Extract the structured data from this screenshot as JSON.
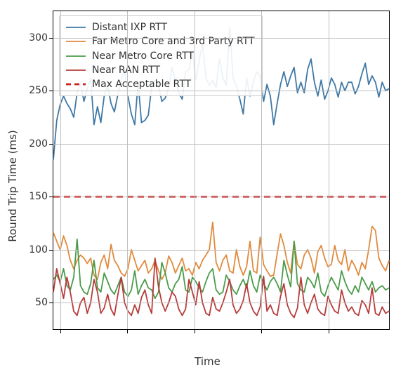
{
  "chart_data": {
    "type": "line",
    "title": "",
    "xlabel": "Time",
    "ylabel": "Round Trip Time (ms)",
    "ylim": [
      25,
      325
    ],
    "yticks": [
      50,
      100,
      150,
      200,
      250,
      300
    ],
    "xlim": [
      0,
      100
    ],
    "xticks": [
      2,
      22,
      42,
      62,
      82
    ],
    "n_points": 100,
    "max_acceptable_rtt": 150,
    "series": [
      {
        "name": "Distant IXP RTT",
        "color": "#3f78a6",
        "style": "solid",
        "values": [
          185,
          222,
          237,
          245,
          238,
          233,
          225,
          248,
          258,
          240,
          252,
          262,
          218,
          235,
          220,
          245,
          255,
          238,
          230,
          246,
          260,
          270,
          245,
          228,
          218,
          258,
          220,
          222,
          227,
          254,
          260,
          255,
          240,
          243,
          253,
          272,
          260,
          248,
          242,
          268,
          270,
          288,
          260,
          278,
          295,
          262,
          255,
          260,
          253,
          280,
          262,
          255,
          310,
          262,
          254,
          242,
          228,
          262,
          245,
          258,
          268,
          264,
          240,
          256,
          245,
          218,
          238,
          256,
          268,
          254,
          264,
          272,
          248,
          258,
          248,
          270,
          280,
          258,
          245,
          260,
          242,
          250,
          262,
          256,
          244,
          258,
          250,
          258,
          258,
          247,
          254,
          266,
          276,
          256,
          264,
          258,
          244,
          258,
          250,
          252
        ]
      },
      {
        "name": "Far Metro Core and 3rd Party RTT",
        "color": "#e08a3c",
        "style": "solid",
        "values": [
          116,
          108,
          100,
          113,
          104,
          90,
          82,
          90,
          95,
          92,
          87,
          92,
          76,
          72,
          88,
          95,
          82,
          105,
          90,
          85,
          78,
          75,
          82,
          100,
          90,
          80,
          85,
          90,
          78,
          82,
          90,
          80,
          72,
          78,
          94,
          88,
          78,
          85,
          92,
          80,
          82,
          76,
          88,
          82,
          90,
          95,
          100,
          126,
          88,
          80,
          90,
          95,
          80,
          78,
          100,
          84,
          76,
          84,
          108,
          80,
          78,
          112,
          86,
          80,
          75,
          76,
          96,
          115,
          104,
          88,
          78,
          108,
          86,
          82,
          95,
          100,
          92,
          78,
          98,
          104,
          92,
          84,
          86,
          104,
          90,
          86,
          100,
          80,
          90,
          84,
          76,
          88,
          82,
          100,
          122,
          118,
          92,
          85,
          80,
          90
        ]
      },
      {
        "name": "Near Metro Core RTT",
        "color": "#4a9b4a",
        "style": "solid",
        "values": [
          72,
          76,
          70,
          82,
          66,
          62,
          74,
          110,
          66,
          60,
          58,
          68,
          90,
          64,
          60,
          78,
          70,
          62,
          58,
          66,
          74,
          60,
          56,
          62,
          80,
          58,
          66,
          72,
          64,
          62,
          54,
          60,
          88,
          78,
          64,
          60,
          68,
          72,
          84,
          62,
          60,
          74,
          70,
          64,
          60,
          70,
          78,
          82,
          62,
          58,
          60,
          76,
          70,
          62,
          58,
          66,
          72,
          64,
          80,
          66,
          60,
          76,
          68,
          62,
          70,
          74,
          68,
          60,
          90,
          76,
          65,
          108,
          68,
          62,
          60,
          74,
          70,
          64,
          78,
          60,
          56,
          66,
          74,
          68,
          62,
          80,
          70,
          62,
          58,
          66,
          60,
          74,
          68,
          62,
          70,
          60,
          64,
          66,
          62,
          64
        ]
      },
      {
        "name": "Near RAN RTT",
        "color": "#b83b3b",
        "style": "solid",
        "values": [
          60,
          82,
          68,
          54,
          74,
          60,
          42,
          38,
          50,
          55,
          40,
          50,
          72,
          60,
          40,
          45,
          58,
          44,
          38,
          57,
          74,
          50,
          42,
          38,
          48,
          40,
          55,
          62,
          48,
          40,
          92,
          65,
          50,
          42,
          50,
          60,
          56,
          44,
          38,
          44,
          72,
          60,
          48,
          70,
          50,
          40,
          38,
          55,
          44,
          42,
          50,
          60,
          72,
          48,
          40,
          44,
          52,
          68,
          50,
          42,
          38,
          46,
          75,
          42,
          48,
          40,
          38,
          56,
          68,
          48,
          40,
          36,
          45,
          74,
          48,
          40,
          50,
          58,
          44,
          40,
          38,
          56,
          48,
          42,
          40,
          62,
          50,
          42,
          46,
          40,
          38,
          52,
          48,
          40,
          64,
          40,
          38,
          46,
          40,
          42
        ]
      }
    ],
    "threshold": {
      "name": "Max Acceptable RTT",
      "color": "#cc1f1f",
      "style": "dashed",
      "value": 150
    },
    "legend": {
      "position": "upper left",
      "entries": [
        "Distant IXP RTT",
        "Far Metro Core and 3rd Party RTT",
        "Near Metro Core RTT",
        "Near RAN RTT",
        "Max Acceptable RTT"
      ]
    }
  }
}
